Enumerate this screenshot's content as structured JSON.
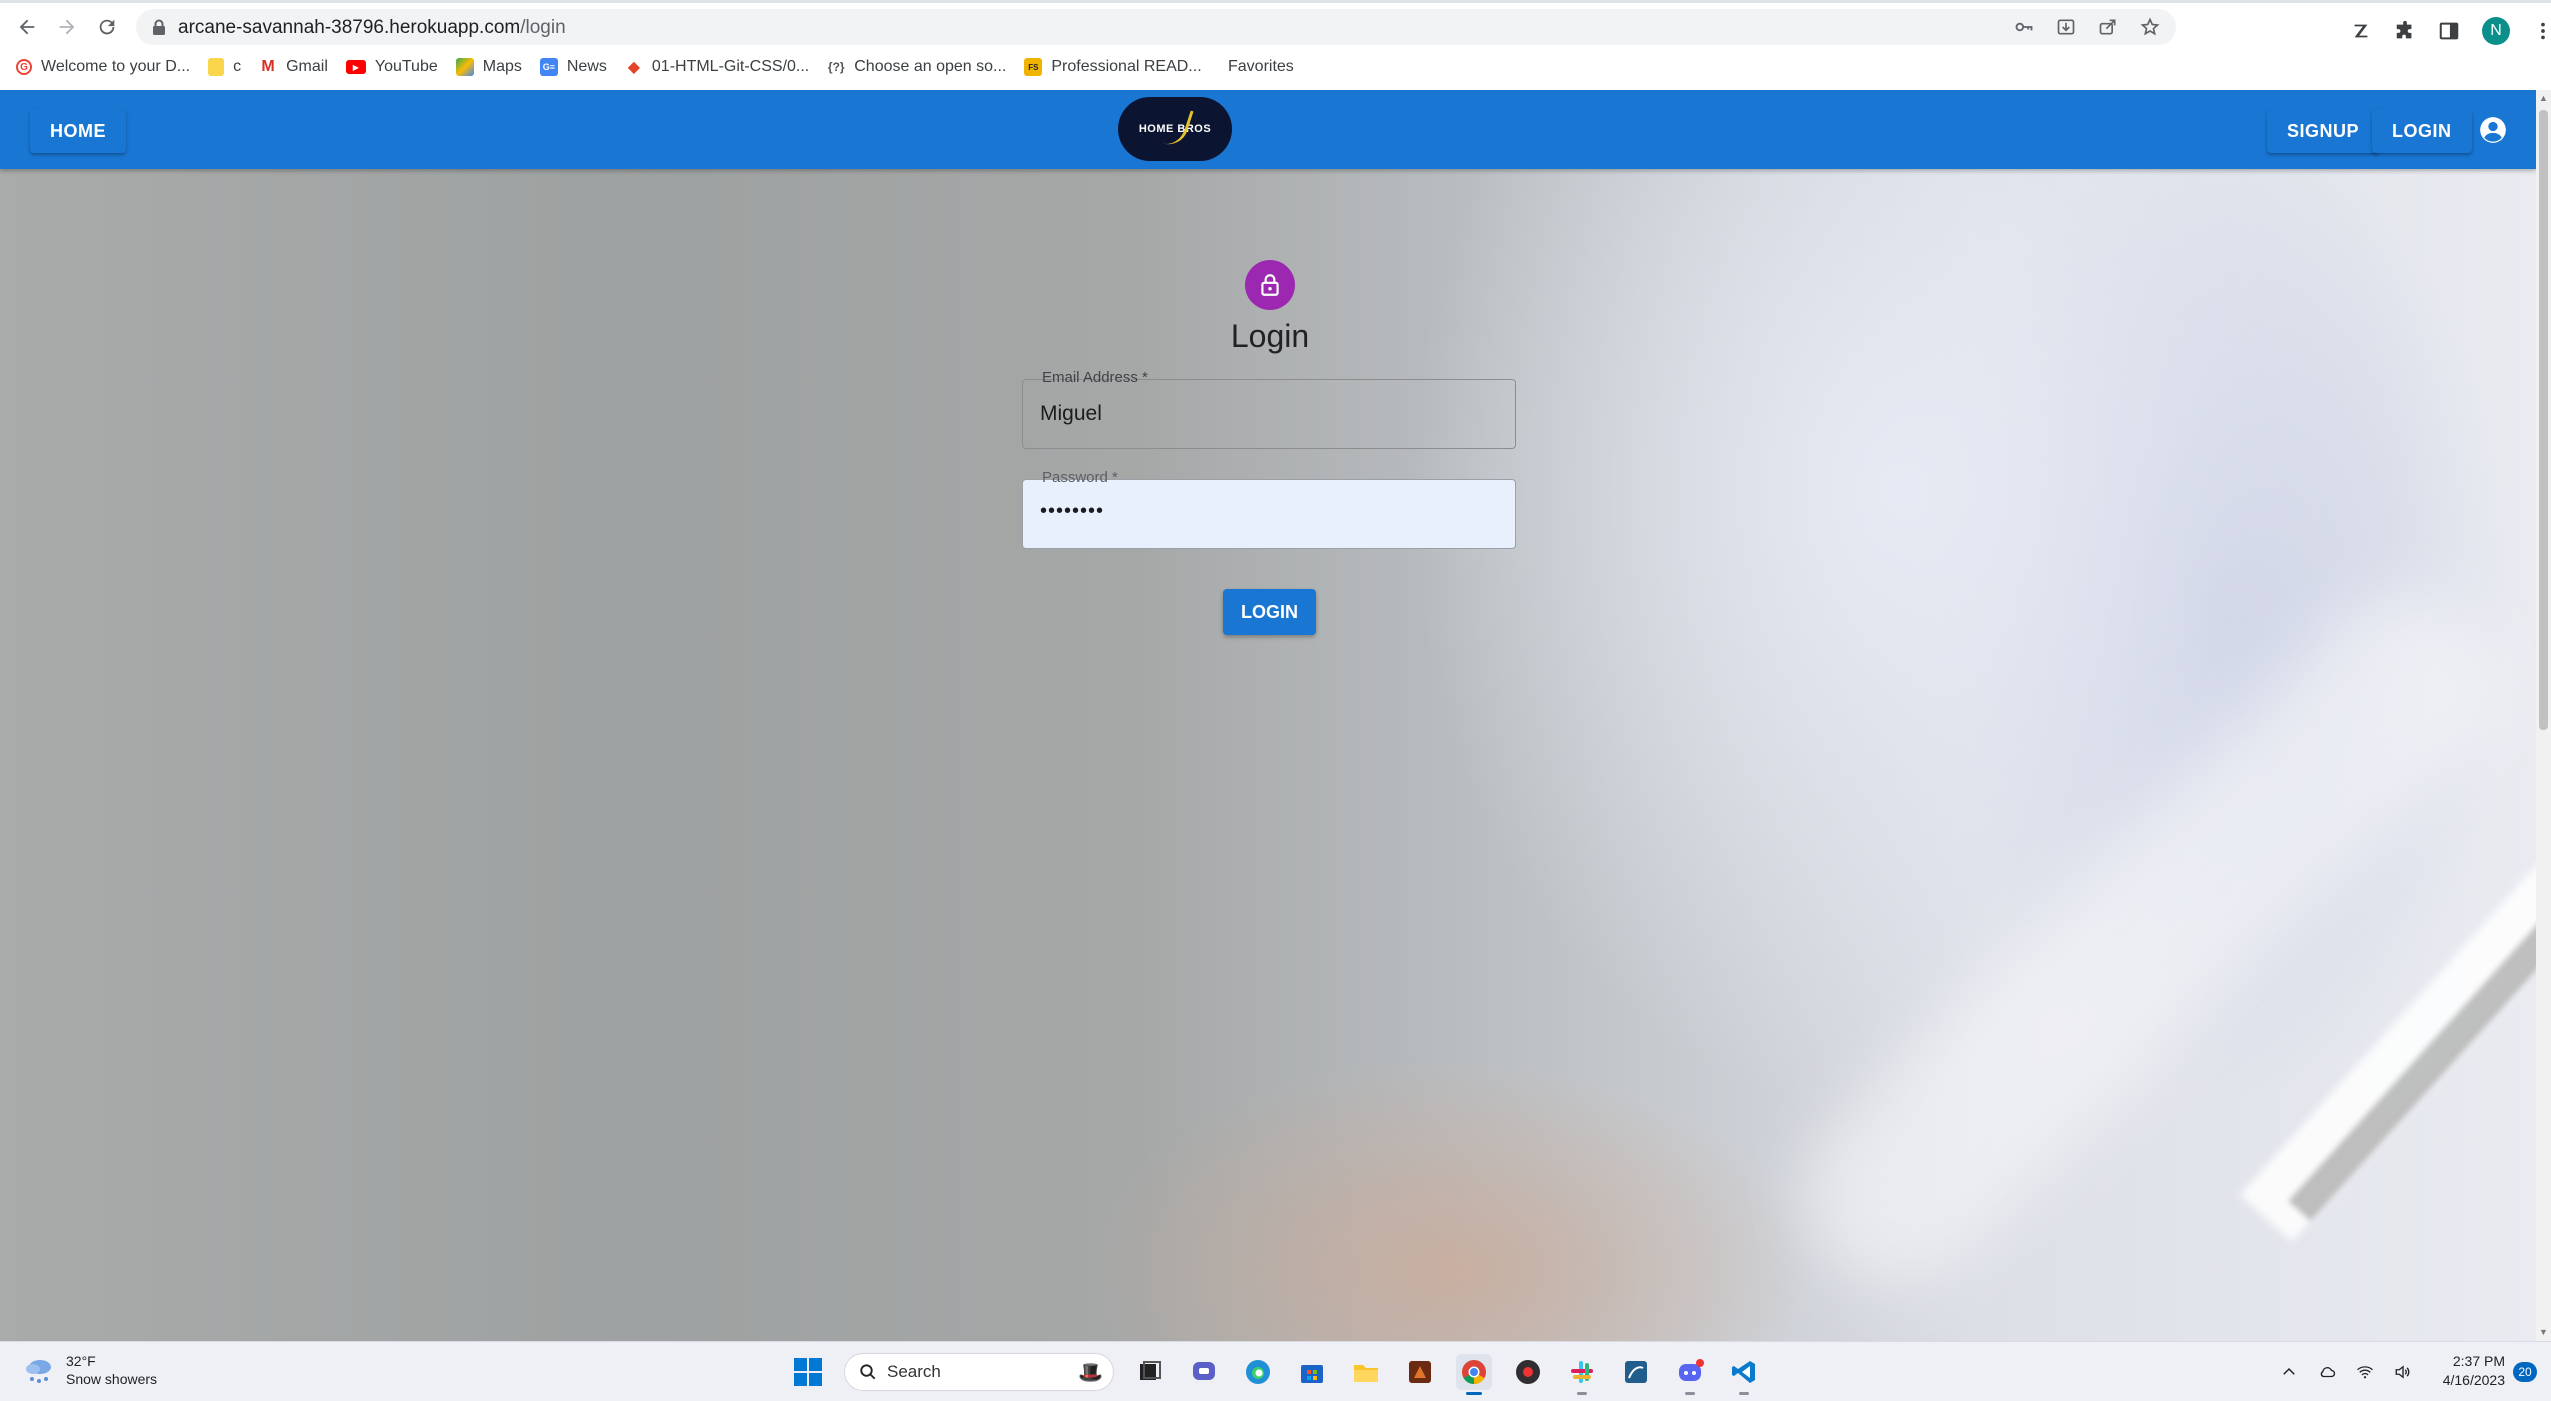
{
  "browser": {
    "url_host": "arcane-savannah-38796.herokuapp.com",
    "url_path": "/login",
    "profile_initial": "N",
    "bookmarks": [
      {
        "label": "Welcome to your D...",
        "icon": "google-g-icon"
      },
      {
        "label": "c",
        "icon": "folder-icon"
      },
      {
        "label": "Gmail",
        "icon": "gmail-icon"
      },
      {
        "label": "YouTube",
        "icon": "youtube-icon"
      },
      {
        "label": "Maps",
        "icon": "maps-icon"
      },
      {
        "label": "News",
        "icon": "news-icon"
      },
      {
        "label": "01-HTML-Git-CSS/0...",
        "icon": "gitlab-icon"
      },
      {
        "label": "Choose an open so...",
        "icon": "question-icon"
      },
      {
        "label": "Professional READ...",
        "icon": "fs-icon"
      }
    ],
    "favorites_label": "Favorites"
  },
  "appbar": {
    "home_label": "HOME",
    "signup_label": "SIGNUP",
    "login_label": "LOGIN",
    "logo_text": "HOME BROS",
    "color": "#1976d2"
  },
  "login_form": {
    "title": "Login",
    "email_label": "Email Address *",
    "email_value": "Miguel",
    "password_label": "Password *",
    "password_value": "••••••••",
    "submit_label": "LOGIN",
    "avatar_color": "#9c27b0"
  },
  "taskbar": {
    "weather_temp": "32°F",
    "weather_desc": "Snow showers",
    "search_placeholder": "Search",
    "time": "2:37 PM",
    "date": "4/16/2023",
    "notification_count": "20"
  }
}
